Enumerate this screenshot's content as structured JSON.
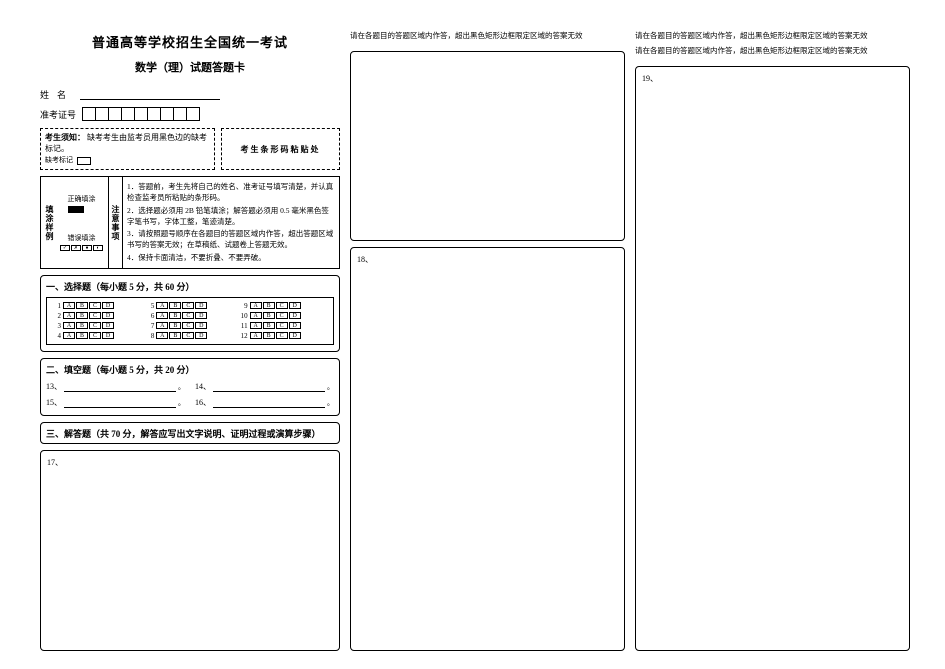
{
  "header": {
    "main_title": "普通高等学校招生全国统一考试",
    "sub_title": "数学（理）试题答题卡"
  },
  "identity": {
    "name_label": "姓名",
    "ticket_label": "准考证号"
  },
  "fill_instruction": {
    "label": "考生须知：",
    "text": "缺考考生由监考员用黑色边的缺考标记。",
    "mark_label": "缺考标记"
  },
  "barcode": {
    "label": "考生条形码粘贴处"
  },
  "samples": {
    "group_label": "填涂样例",
    "correct_label": "正确填涂",
    "wrong_label": "错误填涂",
    "notice_label": "注意事项"
  },
  "notice_items": {
    "n1": "1．答题前，考生先将自己的姓名、准考证号填写清楚，并认真检查监考员所粘贴的条形码。",
    "n2": "2．选择题必须用 2B 铅笔填涂；解答题必须用 0.5 毫米黑色签字笔书写，字体工整，笔迹清楚。",
    "n3": "3．请按照题号顺序在各题目的答题区域内作答，超出答题区域书写的答案无效；在草稿纸、试题卷上答题无效。",
    "n4": "4．保持卡面清洁，不要折叠、不要弄破。"
  },
  "section1": {
    "title": "一、选择题（每小题 5 分，共 60 分）",
    "options": [
      "A",
      "B",
      "C",
      "D"
    ],
    "rows": [
      [
        "1",
        "5",
        "9"
      ],
      [
        "2",
        "6",
        "10"
      ],
      [
        "3",
        "7",
        "11"
      ],
      [
        "4",
        "8",
        "12"
      ]
    ]
  },
  "section2": {
    "title": "二、填空题（每小题 5 分，共 20 分）",
    "q13": "13、",
    "q14": "14、",
    "q15": "15、",
    "q16": "16、"
  },
  "section3": {
    "title": "三、解答题（共 70 分，解答应写出文字说明、证明过程或演算步骤）",
    "q17": "17、"
  },
  "col2": {
    "warn": "请在各题目的答题区域内作答，超出黑色矩形边框限定区域的答案无效",
    "q18": "18、"
  },
  "col3": {
    "warn1": "请在各题目的答题区域内作答，超出黑色矩形边框限定区域的答案无效",
    "warn2": "请在各题目的答题区域内作答，超出黑色矩形边框限定区域的答案无效",
    "q19": "19、"
  }
}
